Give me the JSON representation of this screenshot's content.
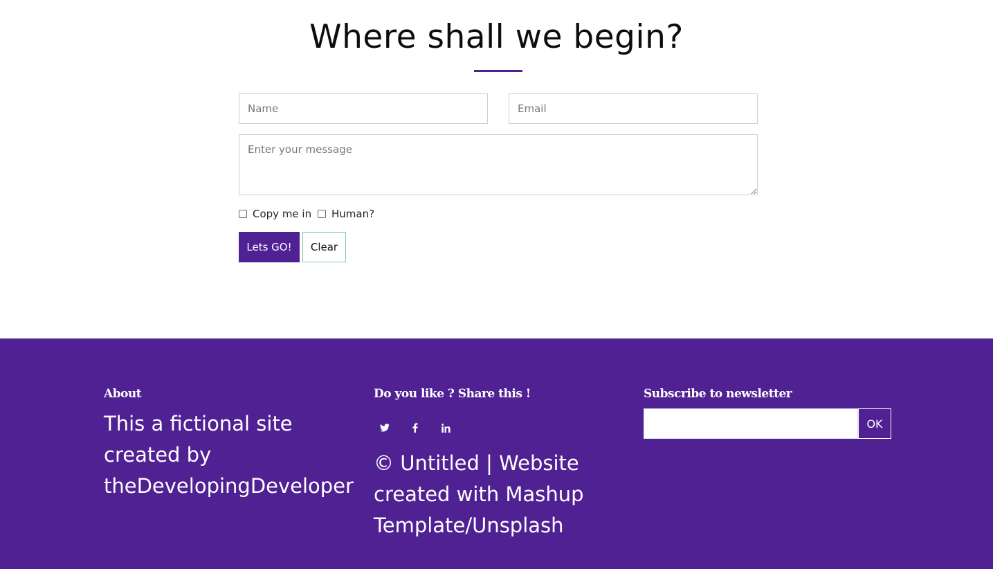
{
  "contact": {
    "title": "Where shall we begin?",
    "name_placeholder": "Name",
    "email_placeholder": "Email",
    "message_placeholder": "Enter your message",
    "copy_label": "Copy me in",
    "human_label": "Human?",
    "submit_label": "Lets GO!",
    "clear_label": "Clear"
  },
  "footer": {
    "about": {
      "heading": "About",
      "lines": [
        "This a fictional site",
        "created by",
        "theDevelopingDeveloper"
      ]
    },
    "share": {
      "heading": "Do you like ? Share this !",
      "icons": [
        "twitter-icon",
        "facebook-icon",
        "linkedin-icon"
      ],
      "copyright_lines": [
        "© Untitled | Website",
        "created with Mashup",
        "Template/Unsplash"
      ]
    },
    "newsletter": {
      "heading": "Subscribe to newsletter",
      "button_label": "OK"
    }
  },
  "colors": {
    "accent": "#4f2192",
    "footer_bg": "#502192",
    "clear_border": "#7fc9b5"
  }
}
